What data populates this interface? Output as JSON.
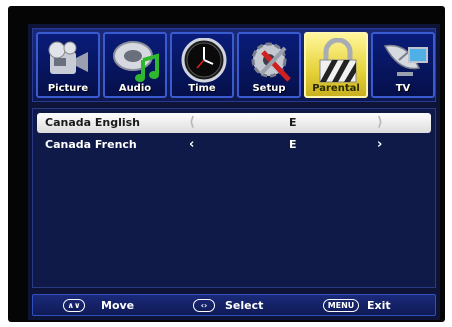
{
  "tabs": [
    {
      "label": "Picture",
      "icon": "camcorder-icon"
    },
    {
      "label": "Audio",
      "icon": "music-note-icon"
    },
    {
      "label": "Time",
      "icon": "clock-icon"
    },
    {
      "label": "Setup",
      "icon": "gear-wrench-icon"
    },
    {
      "label": "Parental",
      "icon": "padlock-icon",
      "active": true
    },
    {
      "label": "TV",
      "icon": "satellite-dish-icon"
    }
  ],
  "rows": [
    {
      "label": "Canada English",
      "left_arrow": "⟨",
      "value": "E",
      "right_arrow": "⟩"
    },
    {
      "label": "Canada French",
      "left_arrow": "‹",
      "value": "E",
      "right_arrow": "›"
    }
  ],
  "footer": {
    "move_icon": "∧∨",
    "move_label": "Move",
    "select_icon": "‹›",
    "select_label": "Select",
    "menu_icon": "MENU",
    "exit_label": "Exit"
  },
  "colors": {
    "background": "#0d1438",
    "tab_border": "#3a5bd0",
    "active_tab": "#e6d23a",
    "selected_row": "#ffffff"
  }
}
